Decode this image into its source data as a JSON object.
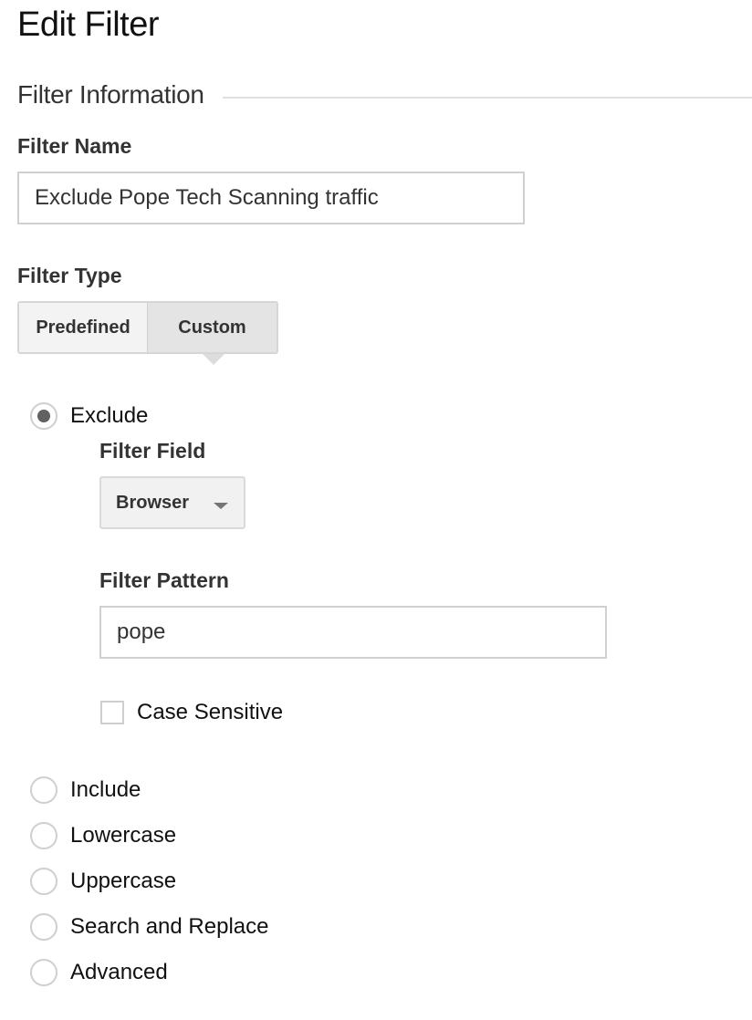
{
  "page": {
    "title": "Edit Filter"
  },
  "section": {
    "title": "Filter Information"
  },
  "filter_name": {
    "label": "Filter Name",
    "value": "Exclude Pope Tech Scanning traffic"
  },
  "filter_type": {
    "label": "Filter Type",
    "options": [
      {
        "label": "Predefined",
        "selected": false
      },
      {
        "label": "Custom",
        "selected": true
      }
    ]
  },
  "custom_options": [
    {
      "label": "Exclude",
      "checked": true
    },
    {
      "label": "Include",
      "checked": false
    },
    {
      "label": "Lowercase",
      "checked": false
    },
    {
      "label": "Uppercase",
      "checked": false
    },
    {
      "label": "Search and Replace",
      "checked": false
    },
    {
      "label": "Advanced",
      "checked": false
    }
  ],
  "filter_field": {
    "label": "Filter Field",
    "selected": "Browser",
    "icon": "caret-down-icon"
  },
  "filter_pattern": {
    "label": "Filter Pattern",
    "value": "pope"
  },
  "case_sensitive": {
    "label": "Case Sensitive",
    "checked": false
  },
  "colors": {
    "text": "#212121",
    "label": "#333333",
    "border": "#d0d0d0",
    "button_bg": "#f3f3f3",
    "button_selected_bg": "#e4e4e4",
    "radio_dot": "#616161"
  }
}
